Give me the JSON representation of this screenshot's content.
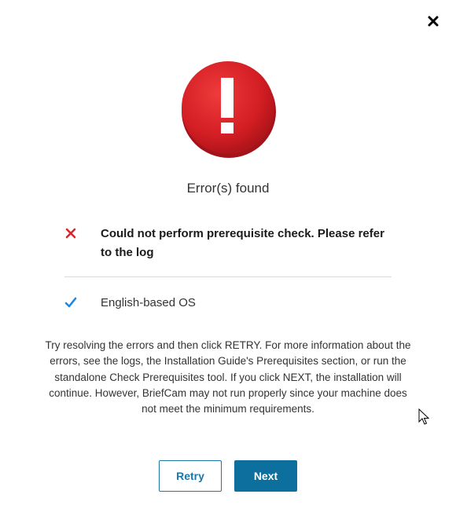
{
  "dialog": {
    "close_icon": "close-icon",
    "status_icon": "error-exclamation-icon",
    "title": "Error(s) found",
    "checks": [
      {
        "status": "error",
        "icon": "x-icon",
        "label": "Could not perform prerequisite check. Please refer to the log"
      },
      {
        "status": "ok",
        "icon": "checkmark-icon",
        "label": "English-based OS"
      }
    ],
    "info_text": "Try resolving the errors and then click RETRY. For more information about the errors, see the logs, the Installation Guide's Prerequisites section, or run the standalone Check Prerequisites tool. If you click NEXT, the installation will continue. However, BriefCam may not run properly since your machine does not meet the minimum requirements.",
    "buttons": {
      "retry": "Retry",
      "next": "Next"
    }
  },
  "colors": {
    "error_red": "#d9262b",
    "success_blue": "#1e88e5",
    "primary_button": "#0d6f9e",
    "secondary_border": "#1a78a8"
  }
}
